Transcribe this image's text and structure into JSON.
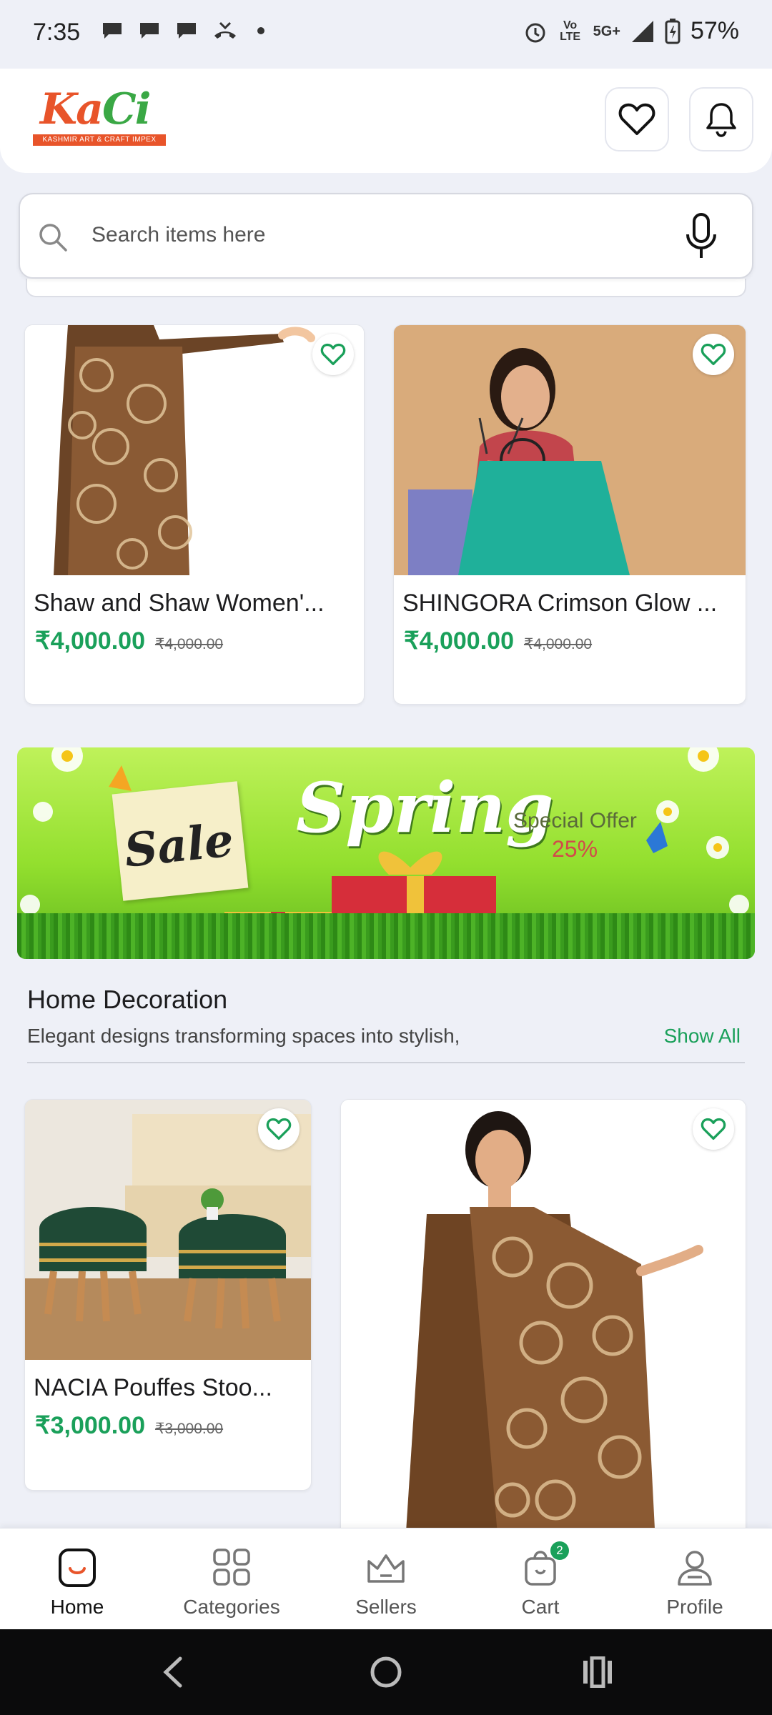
{
  "status_bar": {
    "time": "7:35",
    "network": "5G+",
    "volte": "Vo LTE",
    "battery": "57%"
  },
  "header": {
    "logo_text_main": "Ka",
    "logo_text_accent": "Ci",
    "logo_tagline": "KASHMIR ART & CRAFT IMPEX"
  },
  "search": {
    "placeholder": "Search items here"
  },
  "products_top": [
    {
      "title": "Shaw and Shaw Women'...",
      "price": "₹4,000.00",
      "old_price": "₹4,000.00"
    },
    {
      "title": "SHINGORA Crimson Glow ...",
      "price": "₹4,000.00",
      "old_price": "₹4,000.00"
    }
  ],
  "banner": {
    "spring": "Spring",
    "sale": "Sale",
    "special_offer": "Special Offer",
    "percent": "25%"
  },
  "section": {
    "title": "Home Decoration",
    "subtitle": "Elegant designs transforming spaces into stylish,",
    "show_all": "Show All"
  },
  "products_bottom": [
    {
      "title": "NACIA Pouffes Stoo...",
      "price": "₹3,000.00",
      "old_price": "₹3,000.00"
    }
  ],
  "bottom_nav": [
    {
      "label": "Home"
    },
    {
      "label": "Categories"
    },
    {
      "label": "Sellers"
    },
    {
      "label": "Cart",
      "badge": "2"
    },
    {
      "label": "Profile"
    }
  ],
  "colors": {
    "accent": "#1aa05a",
    "brand_orange": "#e8542a",
    "background": "#eef0f7"
  }
}
